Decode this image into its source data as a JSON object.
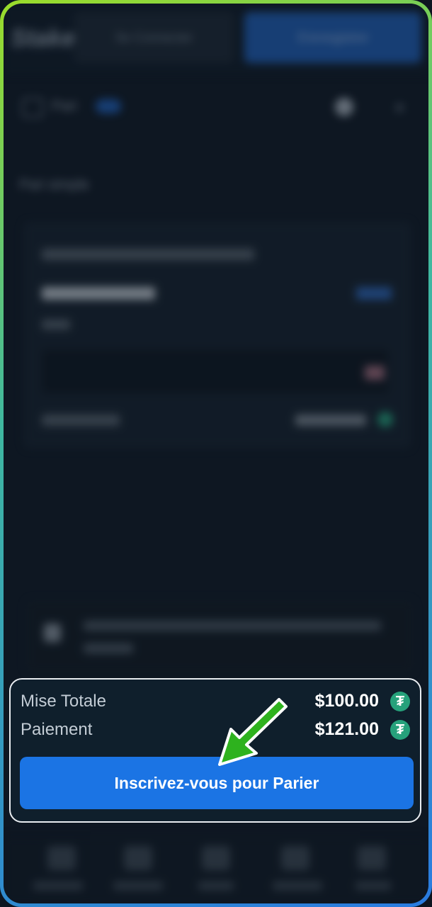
{
  "background_app": {
    "header": {
      "login_label": "Se Connecter",
      "register_label": "S'enregistrer"
    },
    "betslip": {
      "title": "Pari",
      "type_label": "Pari simple"
    }
  },
  "summary": {
    "total_stake_label": "Mise Totale",
    "total_stake_value": "$100.00",
    "payout_label": "Paiement",
    "payout_value": "$121.00",
    "currency_icon": "tether-icon",
    "cta_label": "Inscrivez-vous pour Parier"
  },
  "colors": {
    "accent": "#1b74e4",
    "tether": "#26a17b",
    "arrow": "#2eb21e",
    "highlight_border": "#e9edf1"
  }
}
